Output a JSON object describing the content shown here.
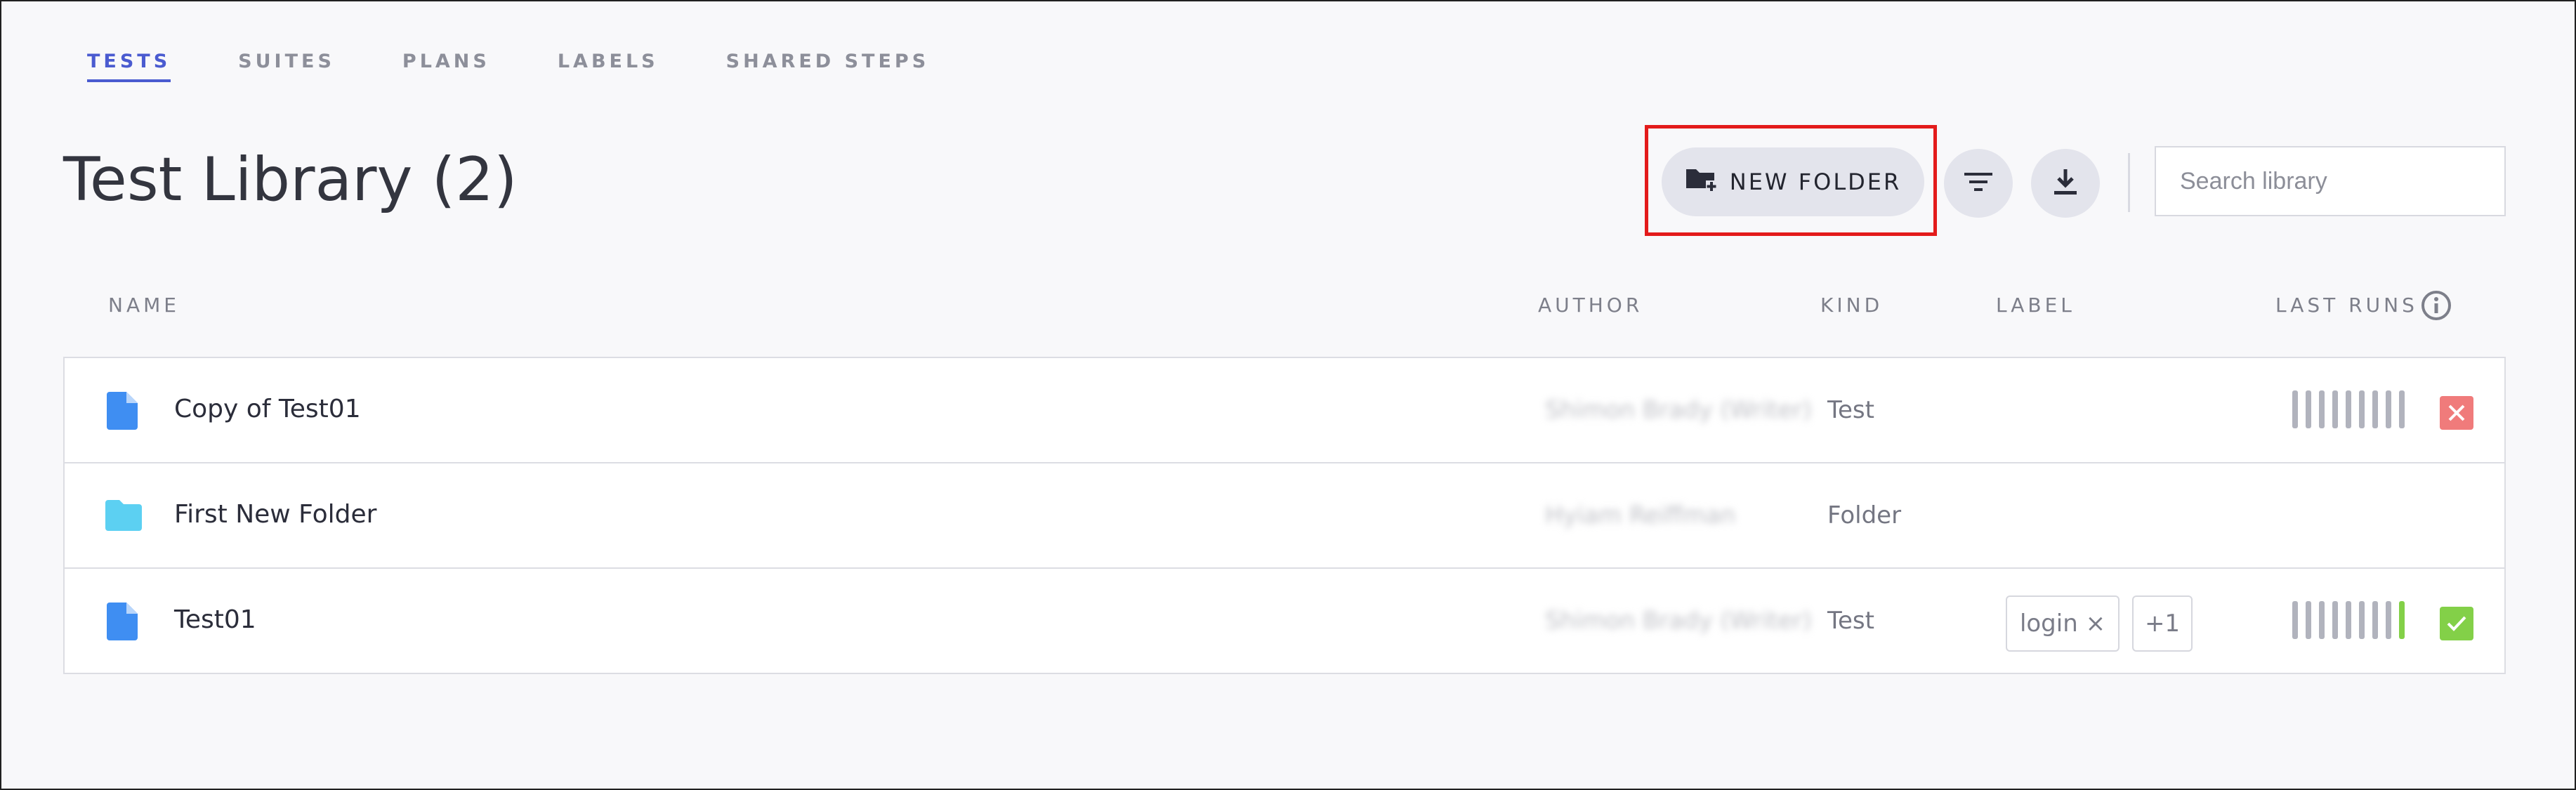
{
  "tabs": [
    {
      "label": "TESTS",
      "active": true
    },
    {
      "label": "SUITES",
      "active": false
    },
    {
      "label": "PLANS",
      "active": false
    },
    {
      "label": "LABELS",
      "active": false
    },
    {
      "label": "SHARED STEPS",
      "active": false
    }
  ],
  "title": "Test Library (2)",
  "toolbar": {
    "new_folder_label": "NEW FOLDER",
    "new_folder_icon": "folder-plus-icon",
    "filter_icon": "filter-icon",
    "download_icon": "download-icon",
    "search_placeholder": "Search library"
  },
  "table": {
    "columns": {
      "name": "NAME",
      "author": "AUTHOR",
      "kind": "KIND",
      "label": "LABEL",
      "last_runs": "LAST RUNS"
    },
    "rows": [
      {
        "name": "Copy of Test01",
        "icon": "file-icon",
        "author": "Shimon Brady (Writer)",
        "kind": "Test",
        "labels": [],
        "last_result": "fail"
      },
      {
        "name": "First New Folder",
        "icon": "folder-icon",
        "author": "Hyiam Reiffman",
        "kind": "Folder",
        "labels": [],
        "last_result": ""
      },
      {
        "name": "Test01",
        "icon": "file-icon",
        "author": "Shimon Brady (Writer)",
        "kind": "Test",
        "labels": [
          "login ×",
          "+1"
        ],
        "last_result": "pass"
      }
    ]
  },
  "colors": {
    "accent": "#4a5bd0",
    "fail": "#f07b7b",
    "pass": "#83d048",
    "file_icon": "#3f8ef2",
    "folder_icon": "#5cd0f2",
    "highlight": "#e31b1b"
  }
}
